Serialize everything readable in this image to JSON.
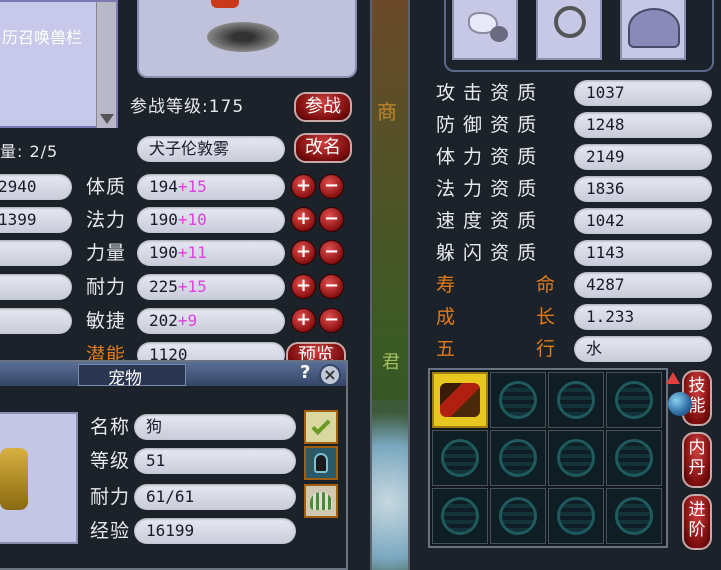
{
  "left_panel": {
    "summon_column_label": "历召唤兽栏",
    "battle_level": "参战等级:175",
    "battle_button": "参战",
    "count_label": "量: 2/5",
    "pet_name": "犬子伦敦雾",
    "rename_button": "改名",
    "left_values": [
      "2940",
      "1399"
    ],
    "stats": [
      {
        "label": "体质",
        "base": "194",
        "bonus": "+15"
      },
      {
        "label": "法力",
        "base": "190",
        "bonus": "+10"
      },
      {
        "label": "力量",
        "base": "190",
        "bonus": "+11"
      },
      {
        "label": "耐力",
        "base": "225",
        "bonus": "+15"
      },
      {
        "label": "敏捷",
        "base": "202",
        "bonus": "+9"
      }
    ],
    "potential_label": "潜能",
    "potential_value": "1120",
    "preset_button": "预览"
  },
  "pet_dialog": {
    "title": "宠物",
    "help": "?",
    "close": "×",
    "rows": [
      {
        "label": "名称",
        "value": "狗"
      },
      {
        "label": "等级",
        "value": "51"
      },
      {
        "label": "耐力",
        "value": "61/61"
      },
      {
        "label": "经验",
        "value": "16199"
      }
    ]
  },
  "right_panel": {
    "aptitudes": [
      {
        "label": "攻 击 资 质",
        "value": "1037",
        "color": "#e8e8f0"
      },
      {
        "label": "防 御 资 质",
        "value": "1248",
        "color": "#e8e8f0"
      },
      {
        "label": "体 力 资 质",
        "value": "2149",
        "color": "#e8e8f0"
      },
      {
        "label": "法 力 资 质",
        "value": "1836",
        "color": "#e8e8f0"
      },
      {
        "label": "速 度 资 质",
        "value": "1042",
        "color": "#e8e8f0"
      },
      {
        "label": "躲 闪 资 质",
        "value": "1143",
        "color": "#e8e8f0"
      }
    ],
    "lifespan": {
      "label_a": "寿",
      "label_b": "命",
      "value": "4287"
    },
    "growth": {
      "label_a": "成",
      "label_b": "长",
      "value": "1.233"
    },
    "element": {
      "label_a": "五",
      "label_b": "行",
      "value": "水"
    },
    "side_buttons": [
      "技能",
      "内丹",
      "进阶"
    ]
  },
  "colors": {
    "panel": "#1c2229",
    "accent_orange": "#e07a1a",
    "bonus_magenta": "#e040e0"
  },
  "world_text": {
    "shop_char": "商",
    "jun_char": "君"
  }
}
